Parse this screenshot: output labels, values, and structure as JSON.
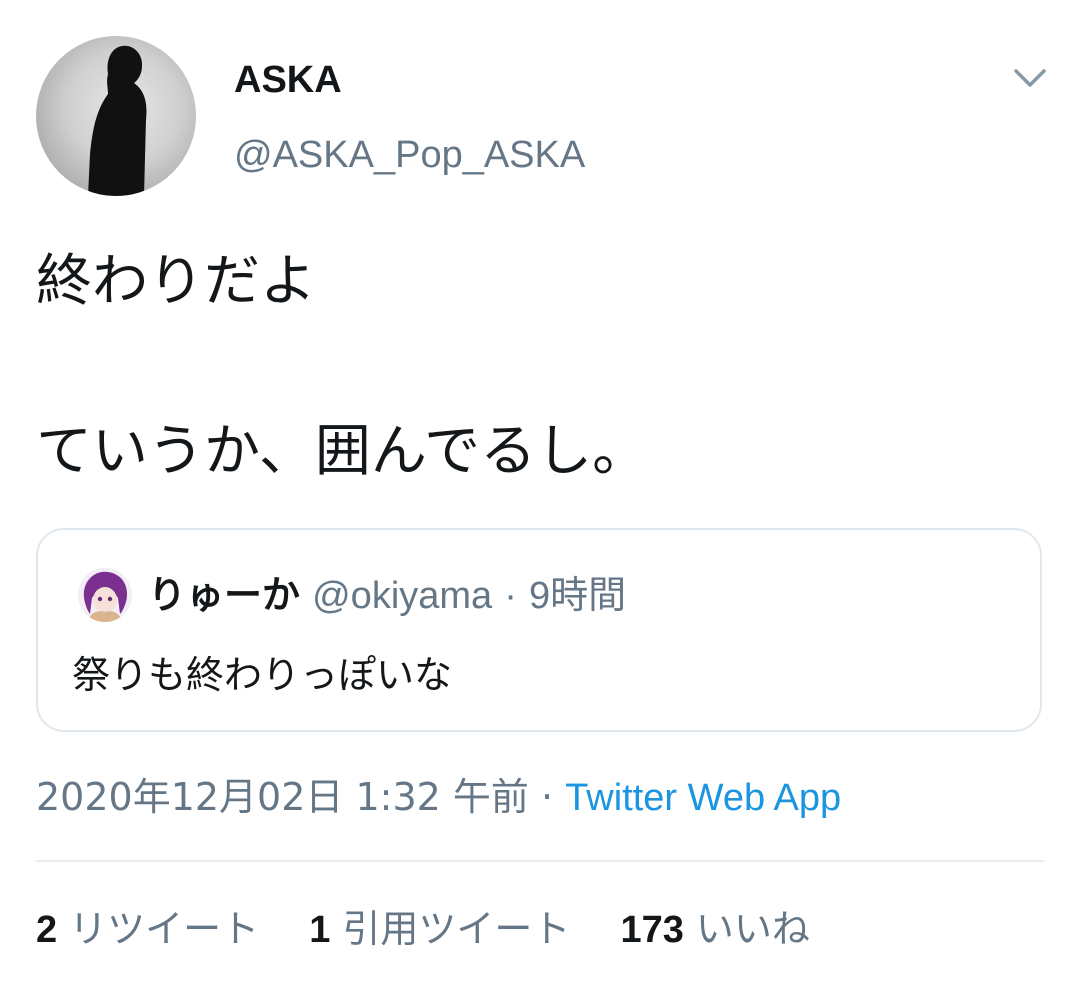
{
  "tweet": {
    "author": {
      "name": "ASKA",
      "handle": "@ASKA_Pop_ASKA",
      "avatar_icon": "user-avatar-silhouette"
    },
    "menu_icon": "chevron-down-icon",
    "text_lines": [
      "終わりだよ",
      "ていうか、囲んでるし。"
    ],
    "quote": {
      "name": "りゅーか",
      "handle": "@okiyama",
      "separator": "·",
      "time": "9時間",
      "text": "祭りも終わりっぽいな",
      "avatar_icon": "quoted-user-avatar"
    },
    "timestamp": "2020年12月02日 1:32 午前",
    "meta_separator": "·",
    "source": "Twitter Web App",
    "stats": [
      {
        "count": "2",
        "label": "リツイート"
      },
      {
        "count": "1",
        "label": "引用ツイート"
      },
      {
        "count": "173",
        "label": "いいね"
      }
    ]
  },
  "colors": {
    "primary_text": "#14171a",
    "secondary_text": "#657786",
    "link": "#1b95e0",
    "border": "#e1e8ed"
  }
}
